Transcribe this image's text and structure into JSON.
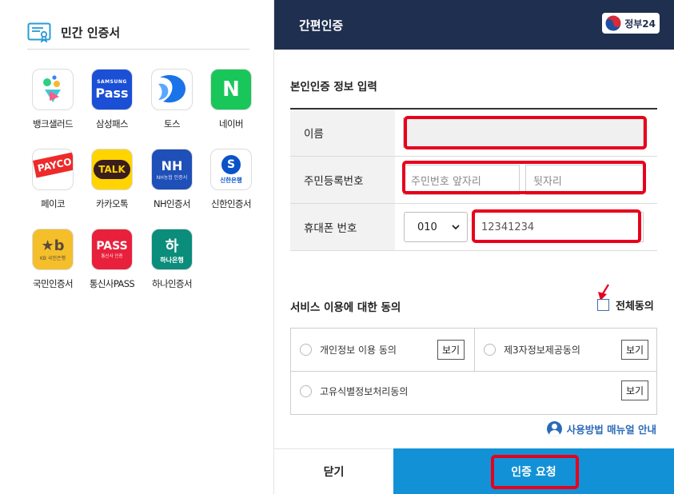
{
  "left_panel": {
    "title": "민간 인증서",
    "apps": [
      {
        "name": "뱅크샐러드",
        "icon": "banksalad-icon"
      },
      {
        "name": "삼성패스",
        "icon": "samsung-pass-icon",
        "logo_small": "SAMSUNG",
        "logo_main": "Pass"
      },
      {
        "name": "토스",
        "icon": "toss-icon"
      },
      {
        "name": "네이버",
        "icon": "naver-icon",
        "logo_main": "N"
      },
      {
        "name": "페이코",
        "icon": "payco-icon",
        "logo_main": "PAYCO"
      },
      {
        "name": "카카오톡",
        "icon": "kakaotalk-icon",
        "logo_main": "TALK"
      },
      {
        "name": "NH인증서",
        "icon": "nh-icon",
        "logo_main": "NH",
        "logo_small": "NH농협 인증서"
      },
      {
        "name": "신한인증서",
        "icon": "shinhan-icon",
        "logo_main": "S",
        "logo_small": "신한은행"
      },
      {
        "name": "국민인증서",
        "icon": "kb-icon",
        "logo_main": "★b",
        "logo_small": "KB 국민은행"
      },
      {
        "name": "통신사PASS",
        "icon": "pass-icon",
        "logo_main": "PASS",
        "logo_small": "통신사 인증"
      },
      {
        "name": "하나인증서",
        "icon": "hana-icon",
        "logo_main": "하",
        "logo_small": "하나은행"
      }
    ]
  },
  "header": {
    "title": "간편인증",
    "logo_text": "정부24"
  },
  "form": {
    "section_title": "본인인증 정보 입력",
    "name_label": "이름",
    "name_value": "",
    "rrn_label": "주민등록번호",
    "rrn_front_placeholder": "주민번호 앞자리",
    "rrn_back_placeholder": "뒷자리",
    "phone_label": "휴대폰 번호",
    "carrier_prefix": "010",
    "phone_value": "12341234"
  },
  "agreement": {
    "title": "서비스 이용에 대한 동의",
    "all_agree_label": "전체동의",
    "items": [
      {
        "label": "개인정보 이용 동의",
        "view_label": "보기"
      },
      {
        "label": "제3자정보제공동의",
        "view_label": "보기"
      },
      {
        "label": "고유식별정보처리동의",
        "view_label": "보기"
      }
    ]
  },
  "manual_link": "사용방법 매뉴얼 안내",
  "footer": {
    "close_label": "닫기",
    "request_label": "인증 요청"
  },
  "colors": {
    "header_bg": "#1f2f4f",
    "primary_button": "#1391d6",
    "highlight": "#e8001c",
    "link": "#2a6bb8"
  }
}
